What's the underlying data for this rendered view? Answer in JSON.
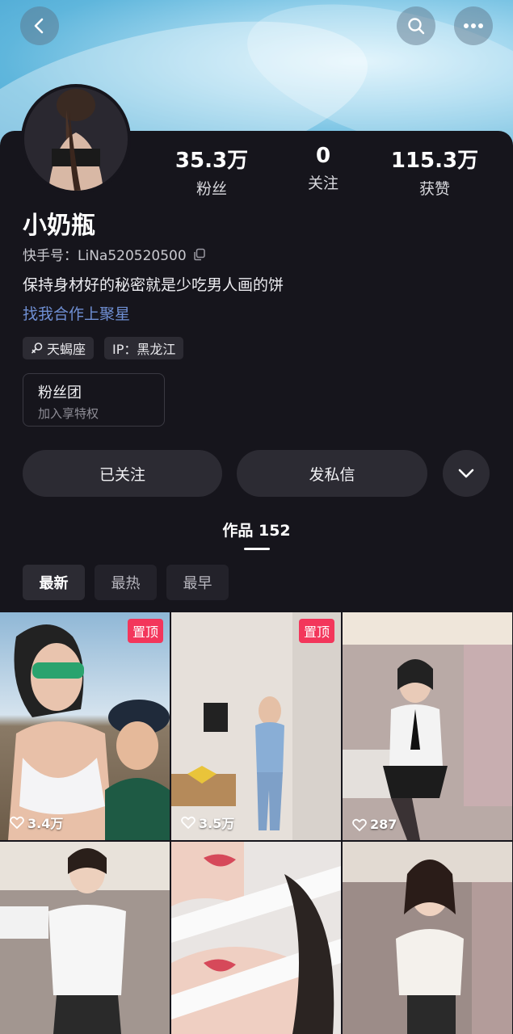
{
  "profile": {
    "name": "小奶瓶",
    "id_label": "快手号：",
    "id_value": "LiNa520520500",
    "bio": "保持身材好的秘密就是少吃男人画的饼",
    "link": "找我合作上聚星"
  },
  "stats": [
    {
      "num": "35.3万",
      "label": "粉丝"
    },
    {
      "num": "0",
      "label": "关注"
    },
    {
      "num": "115.3万",
      "label": "获赞"
    }
  ],
  "tags": {
    "zodiac": "天蝎座",
    "ip": "IP：黑龙江"
  },
  "fan_club": {
    "title": "粉丝团",
    "subtitle": "加入享特权"
  },
  "actions": {
    "followed": "已关注",
    "message": "发私信"
  },
  "works_tab": "作品 152",
  "sort": [
    "最新",
    "最热",
    "最早"
  ],
  "videos": [
    {
      "likes": "3.4万",
      "pinned": "置顶"
    },
    {
      "likes": "3.5万",
      "pinned": "置顶"
    },
    {
      "likes": "287",
      "pinned": ""
    },
    {
      "likes": "",
      "pinned": ""
    },
    {
      "likes": "",
      "pinned": ""
    },
    {
      "likes": "",
      "pinned": ""
    }
  ],
  "colors": {
    "background": "#16151c",
    "accent_link": "#6f8fd3",
    "pin_badge": "#f3365b"
  },
  "icons": {
    "back": "back-icon",
    "search": "search-icon",
    "more": "more-icon",
    "copy": "copy-icon",
    "zodiac": "zodiac-icon",
    "dropdown": "chevron-down-icon",
    "like": "heart-icon"
  }
}
